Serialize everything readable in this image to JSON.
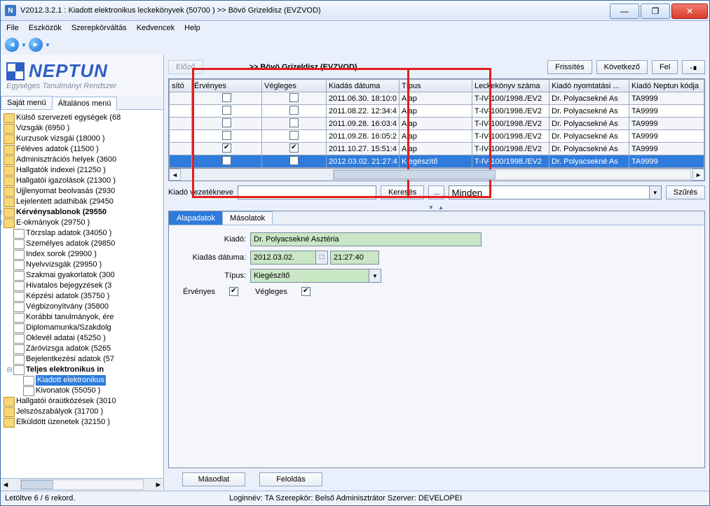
{
  "window": {
    "title": "V2012.3.2.1 : Kiadott elektronikus leckekönyvek (50700 )  >> Bövö Grizeldisz (EVZVOD)"
  },
  "menubar": [
    "File",
    "Eszközök",
    "Szerepkörváltás",
    "Kedvencek",
    "Help"
  ],
  "logo": {
    "brand": "NEPTUN",
    "tag": "Egységes Tanulmányi Rendszer"
  },
  "left_tabs": {
    "a": "Saját menü",
    "b": "Általános menü"
  },
  "tree": [
    {
      "lbl": "Külső szervezeti egységek (68"
    },
    {
      "lbl": "Vizsgák (6950 )"
    },
    {
      "lbl": "Kurzusok vizsgái (18000 )"
    },
    {
      "lbl": "Féléves adatok (11500 )"
    },
    {
      "lbl": "Adminisztrációs helyek (3600"
    },
    {
      "lbl": "Hallgatók indexei (21250 )"
    },
    {
      "lbl": "Hallgatói igazolások (21300 )"
    },
    {
      "lbl": "Ujjlenyomat beolvasás (2930"
    },
    {
      "lbl": "Lejelentett adathibák (29450"
    },
    {
      "lbl": "Kérvénysablonok (29550",
      "bold": true,
      "exp": "+"
    },
    {
      "lbl": "E-okmányok (29750 )",
      "exp": "-",
      "children": [
        {
          "lbl": "Törzslap adatok (34050 )",
          "doc": true
        },
        {
          "lbl": "Személyes adatok (29850",
          "doc": true
        },
        {
          "lbl": "Index sorok (29900 )",
          "doc": true
        },
        {
          "lbl": "Nyelvvizsgák (29950 )",
          "doc": true
        },
        {
          "lbl": "Szakmai gyakorlatok (300",
          "doc": true
        },
        {
          "lbl": "Hivatalos bejegyzések (3",
          "doc": true
        },
        {
          "lbl": "Képzési adatok (35750 )",
          "doc": true
        },
        {
          "lbl": "Végbizonyítvány (35800",
          "doc": true
        },
        {
          "lbl": "Korábbi tanulmányok, ére",
          "doc": true
        },
        {
          "lbl": "Diplomamunka/Szakdolg",
          "doc": true
        },
        {
          "lbl": "Oklevél adatai (45250 )",
          "doc": true
        },
        {
          "lbl": "Záróvizsga adatok (5265",
          "doc": true
        },
        {
          "lbl": "Bejelentkezési adatok (57",
          "doc": true
        },
        {
          "lbl": "Teljes elektronikus in",
          "doc": true,
          "bold": true,
          "exp": "-",
          "children": [
            {
              "lbl": "Kiadott elektronikus",
              "doc": true,
              "sel": true
            },
            {
              "lbl": "Kivonatok (55050 )",
              "doc": true
            }
          ]
        }
      ]
    },
    {
      "lbl": "Hallgatói óraütközések (3010"
    },
    {
      "lbl": "Jelszószabályok (31700 )"
    },
    {
      "lbl": "Elküldött üzenetek (32150 )"
    }
  ],
  "crumb": ">> Bövö Grizeldisz (EVZVOD)",
  "crumb_btn": "Előző",
  "toolbar": {
    "refresh": "Frissítés",
    "next": "Következő",
    "up": "Fel",
    "pin": "-∎"
  },
  "grid": {
    "headers": [
      "sító",
      "Érvényes",
      "Végleges",
      "Kiadás dátuma",
      "Típus",
      "Leckekönyv száma",
      "Kiadó nyomtatási ...",
      "Kiadó Neptun kódja"
    ],
    "rows": [
      {
        "erv": false,
        "veg": false,
        "date": "2011.06.30. 18:10:0",
        "tip": "Alap",
        "szam": "T-IV-100/1998./EV2",
        "kiado": "Dr. Polyacsekné As",
        "kod": "TA9999"
      },
      {
        "erv": false,
        "veg": false,
        "date": "2011.08.22. 12:34:4",
        "tip": "Alap",
        "szam": "T-IV-100/1998./EV2",
        "kiado": "Dr. Polyacsekné As",
        "kod": "TA9999"
      },
      {
        "erv": false,
        "veg": false,
        "date": "2011.09.28. 16:03:4",
        "tip": "Alap",
        "szam": "T-IV-100/1998./EV2",
        "kiado": "Dr. Polyacsekné As",
        "kod": "TA9999"
      },
      {
        "erv": false,
        "veg": false,
        "date": "2011.09.28. 16:05:2",
        "tip": "Alap",
        "szam": "T-IV-100/1998./EV2",
        "kiado": "Dr. Polyacsekné As",
        "kod": "TA9999"
      },
      {
        "erv": true,
        "veg": true,
        "date": "2011.10.27. 15:51:4",
        "tip": "Alap",
        "szam": "T-IV-100/1998./EV2",
        "kiado": "Dr. Polyacsekné As",
        "kod": "TA9999"
      },
      {
        "erv": true,
        "veg": true,
        "date": "2012.03.02. 21:27:4",
        "tip": "Kiegészítő",
        "szam": "T-IV-100/1998./EV2",
        "kiado": "Dr. Polyacsekné As",
        "kod": "TA9999",
        "sel": true
      }
    ]
  },
  "search": {
    "label": "Kiadó vezetékneve",
    "keres": "Keresés",
    "dots": "...",
    "minden": "Minden",
    "szures": "Szűrés"
  },
  "detail_tabs": {
    "a": "Alapadatok",
    "b": "Másolatok"
  },
  "form": {
    "kiado_lbl": "Kiadó:",
    "kiado_val": "Dr. Polyacsekné Asztéria",
    "kdate_lbl": "Kiadás dátuma:",
    "kdate_val": "2012.03.02.",
    "ktime_val": "21:27:40",
    "tipus_lbl": "Típus:",
    "tipus_val": "Kiegészítő",
    "erv_lbl": "Érvényes",
    "veg_lbl": "Végleges"
  },
  "bottom": {
    "masodlat": "Másodlat",
    "feloldas": "Feloldás"
  },
  "status": {
    "left": "Letöltve 6 / 6 rekord.",
    "mid": "Loginnév: TA    Szerepkör: Belső Adminisztrátor    Szerver: DEVELOPEI"
  }
}
